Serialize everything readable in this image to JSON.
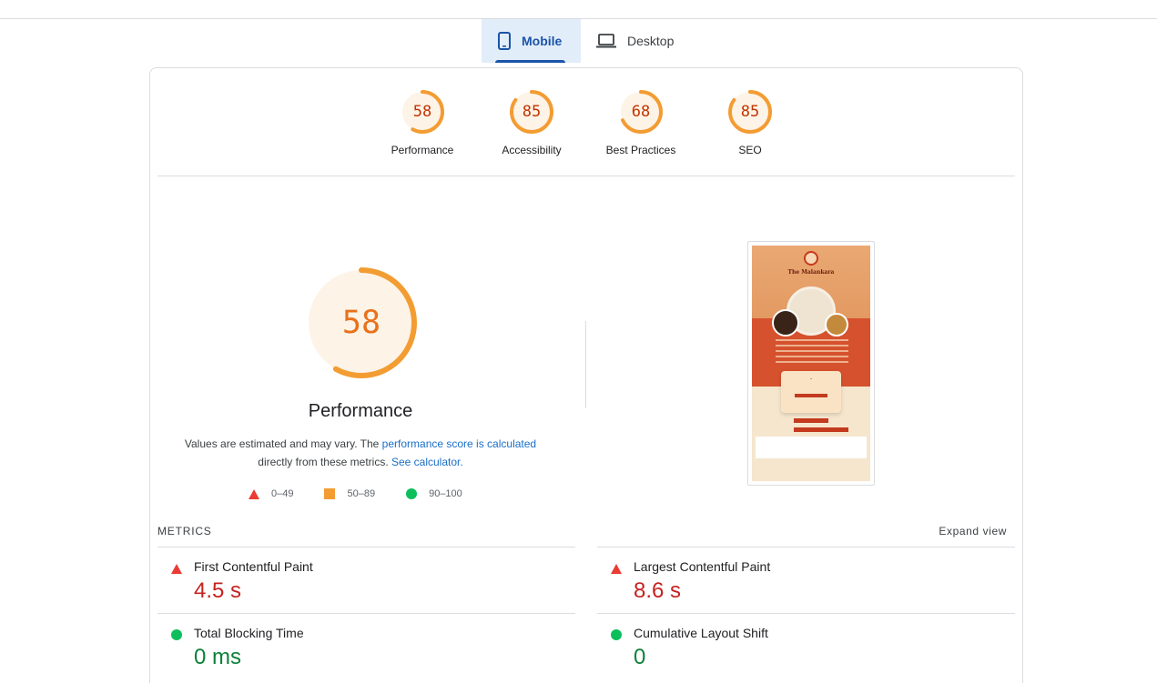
{
  "tabs": [
    {
      "label": "Mobile",
      "icon": "phone-icon",
      "active": true
    },
    {
      "label": "Desktop",
      "icon": "laptop-icon",
      "active": false
    }
  ],
  "categories": [
    {
      "score": "58",
      "label": "Performance",
      "fraction": 0.58
    },
    {
      "score": "85",
      "label": "Accessibility",
      "fraction": 0.85
    },
    {
      "score": "68",
      "label": "Best Practices",
      "fraction": 0.68
    },
    {
      "score": "85",
      "label": "SEO",
      "fraction": 0.85
    }
  ],
  "performance": {
    "score": "58",
    "fraction": 0.58,
    "title": "Performance",
    "desc_prefix": "Values are estimated and may vary. The ",
    "desc_link": "performance score is calculated",
    "desc_mid": " directly from these metrics. ",
    "desc_link2": "See calculator."
  },
  "legend": [
    {
      "range": "0–49",
      "symbol": "red-triangle-icon"
    },
    {
      "range": "50–89",
      "symbol": "orange-square-icon"
    },
    {
      "range": "90–100",
      "symbol": "green-circle-icon"
    }
  ],
  "thumbnail": {
    "site_title": "The Malankara"
  },
  "metrics_header": "METRICS",
  "expand_label": "Expand view",
  "metrics": [
    {
      "name": "First Contentful Paint",
      "value": "4.5 s",
      "status": "fail"
    },
    {
      "name": "Largest Contentful Paint",
      "value": "8.6 s",
      "status": "fail"
    },
    {
      "name": "Total Blocking Time",
      "value": "0 ms",
      "status": "pass"
    },
    {
      "name": "Cumulative Layout Shift",
      "value": "0",
      "status": "pass"
    }
  ],
  "colors": {
    "fail": "#c5221f",
    "average": "#e8711a",
    "pass": "#0c8139",
    "accent": "#1a54a8"
  }
}
